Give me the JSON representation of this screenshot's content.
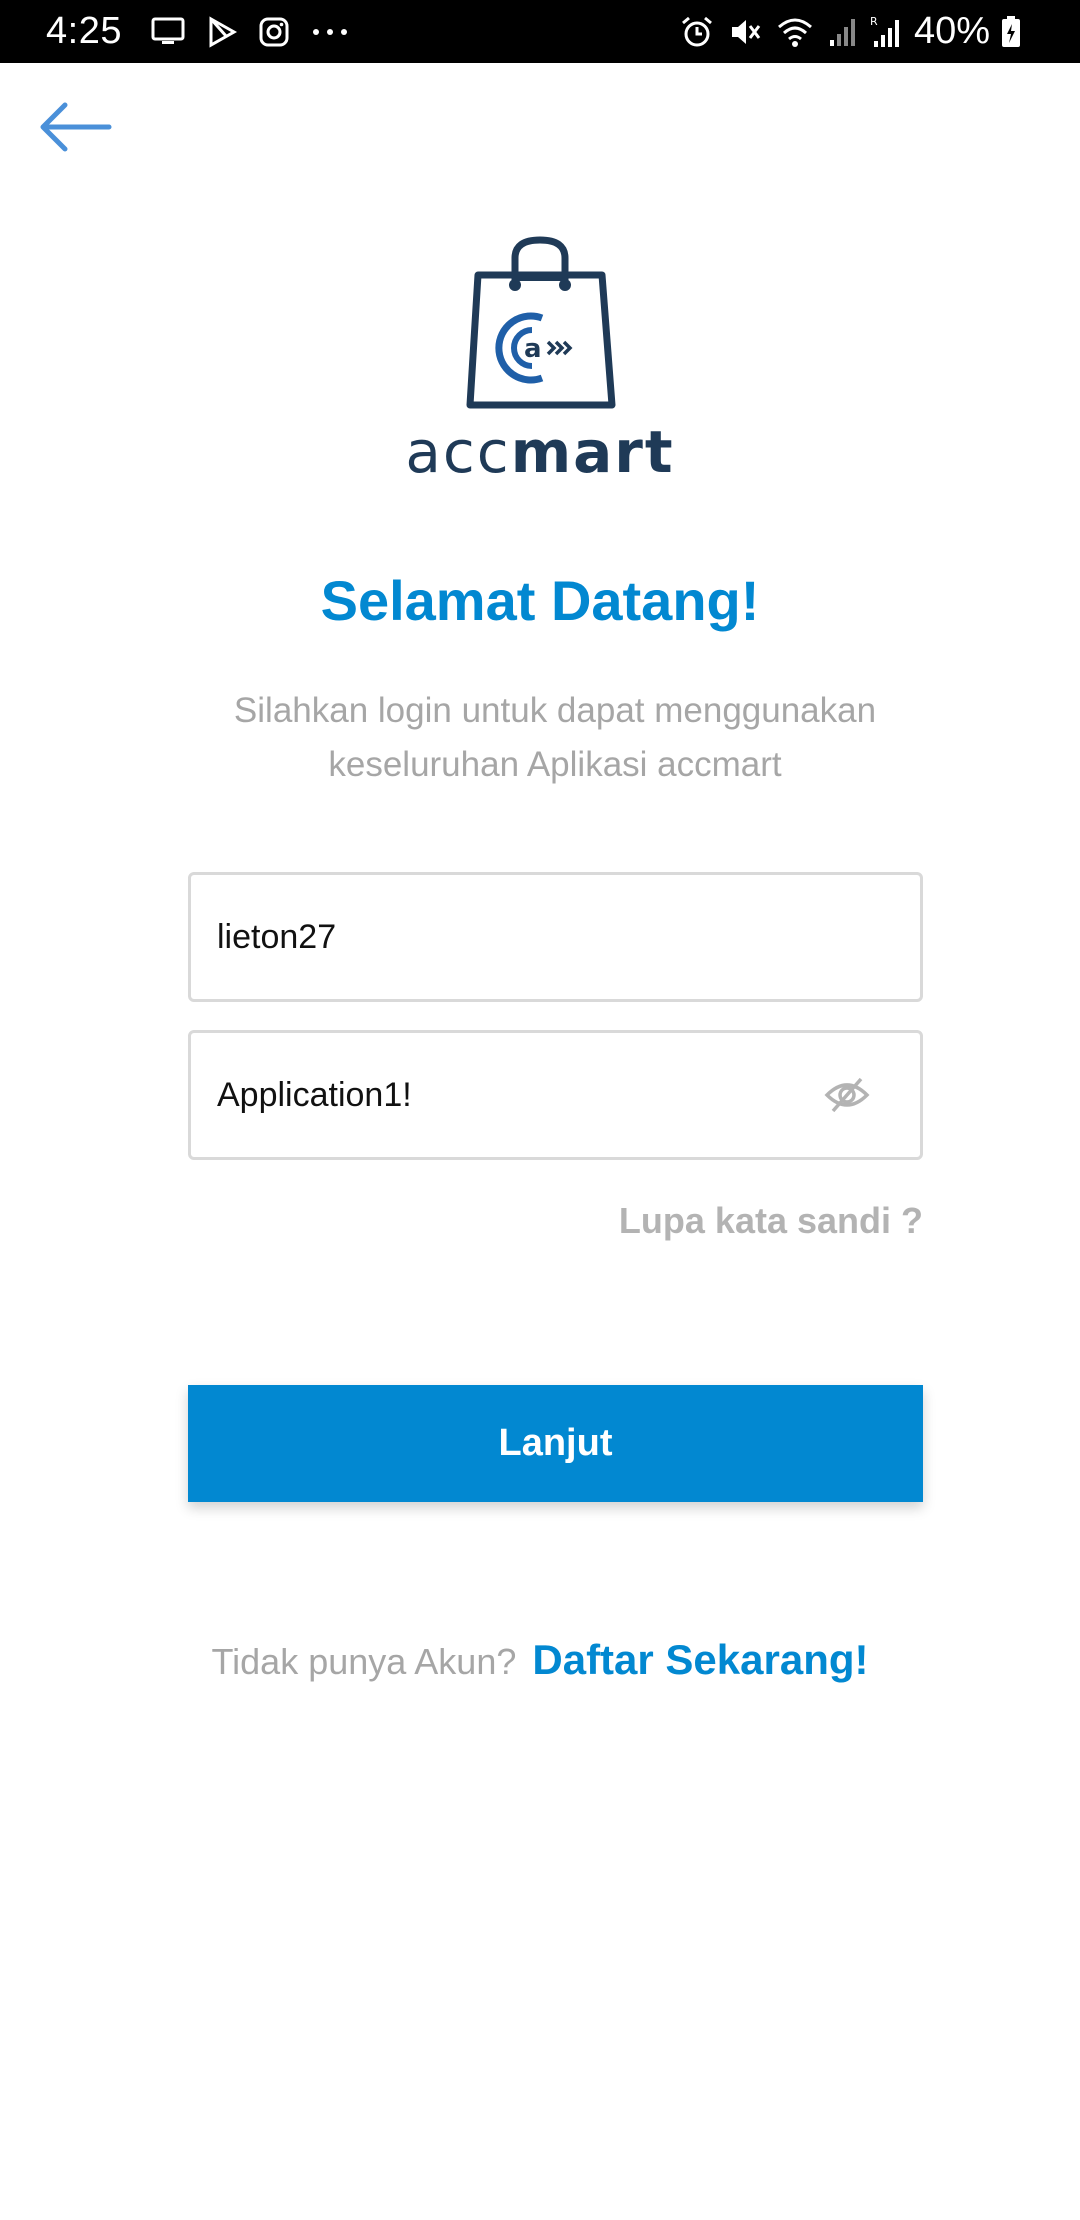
{
  "status_bar": {
    "time": "4:25",
    "battery": "40%",
    "left_icons": [
      "tv-icon",
      "play-store-icon",
      "instagram-icon",
      "more-dots-icon"
    ],
    "right_icons": [
      "alarm-icon",
      "mute-icon",
      "wifi-icon",
      "signal-icon",
      "signal-roaming-icon",
      "battery-charging-icon"
    ]
  },
  "header": {
    "back_icon": "arrow-left-icon",
    "accent_color": "#4a90d9"
  },
  "logo": {
    "text_light": "acc",
    "text_bold": "mart",
    "icon": "shopping-bag-logo-icon",
    "color": "#1f3a57"
  },
  "title": "Selamat Datang!",
  "subtitle": "Silahkan login untuk dapat menggunakan keseluruhan Aplikasi accmart",
  "form": {
    "username_value": "lieton27",
    "password_value": "Application1!",
    "password_toggle_icon": "eye-off-icon"
  },
  "forgot_password_label": "Lupa kata sandi ?",
  "submit_label": "Lanjut",
  "signup": {
    "prompt": "Tidak punya Akun?",
    "link": "Daftar Sekarang!"
  },
  "colors": {
    "primary": "#0288d1",
    "muted_text": "#a6a6a6",
    "border": "#d9d9d9"
  }
}
